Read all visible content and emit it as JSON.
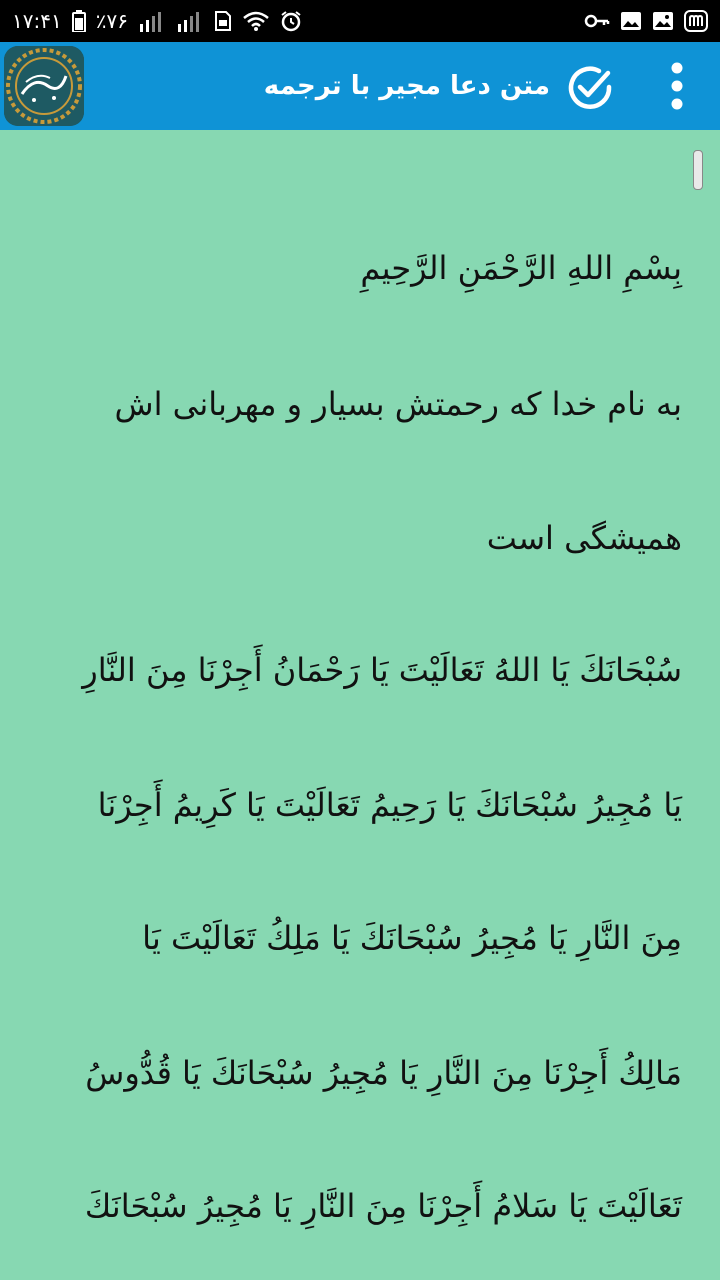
{
  "status_bar": {
    "time": "۱۷:۴۱",
    "battery_percent": "٪۷۶"
  },
  "app_bar": {
    "title": "متن دعا مجیر با ترجمه",
    "logo_text": "دعای مجیر",
    "menu_icon": "more-vert-icon",
    "check_icon": "check-circle-icon"
  },
  "content": {
    "lines": [
      "بِسْمِ اللهِ الرَّحْمَنِ الرَّحِيمِ",
      "به نام خدا که رحمتش بسیار و مهربانی اش",
      "همیشگی است",
      "سُبْحَانَكَ يَا اللهُ تَعَالَيْتَ يَا رَحْمَانُ أَجِرْنَا مِنَ النَّارِ",
      "يَا مُجِيرُ سُبْحَانَكَ يَا رَحِيمُ تَعَالَيْتَ يَا كَرِيمُ أَجِرْنَا",
      "مِنَ النَّارِ يَا مُجِيرُ سُبْحَانَكَ يَا مَلِكُ تَعَالَيْتَ يَا",
      "مَالِكُ أَجِرْنَا مِنَ النَّارِ يَا مُجِيرُ سُبْحَانَكَ يَا قُدُّوسُ",
      "تَعَالَيْتَ يَا سَلامُ أَجِرْنَا مِنَ النَّارِ يَا مُجِيرُ سُبْحَانَكَ"
    ]
  },
  "colors": {
    "app_bar": "#0F93D6",
    "background": "#87D8B2",
    "status_bar": "#000000"
  }
}
